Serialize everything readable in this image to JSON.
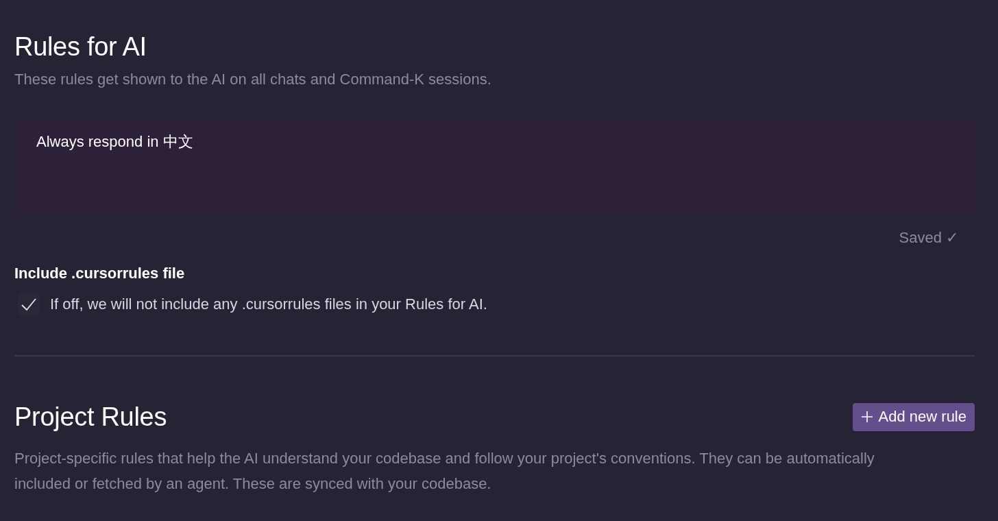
{
  "rules_for_ai": {
    "title": "Rules for AI",
    "subtitle": "These rules get shown to the AI on all chats and Command-K sessions.",
    "rules_field": {
      "value": "Always respond in 中文"
    },
    "save_status": "Saved ✓"
  },
  "include_cursorrules": {
    "label": "Include .cursorrules file",
    "checked": true,
    "description": "If off, we will not include any .cursorrules files in your Rules for AI."
  },
  "project_rules": {
    "title": "Project Rules",
    "add_button": "Add new rule",
    "description": "Project-specific rules that help the AI understand your codebase and follow your project's conventions. They can be automatically included or fetched by an agent. These are synced with your codebase."
  }
}
